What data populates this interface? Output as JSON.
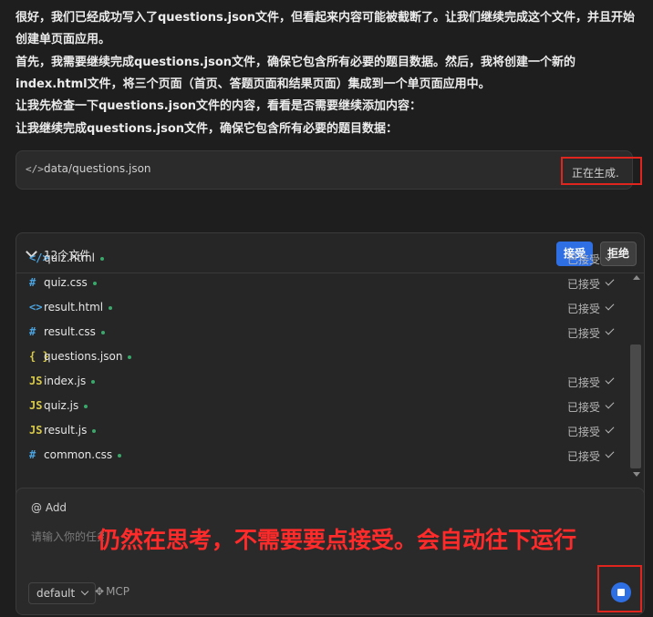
{
  "chat": {
    "para1": "很好，我们已经成功写入了questions.json文件，但看起来内容可能被截断了。让我们继续完成这个文件，并且开始创建单页面应用。",
    "para2": "首先，我需要继续完成questions.json文件，确保它包含所有必要的题目数据。然后，我将创建一个新的index.html文件，将三个页面（首页、答题页面和结果页面）集成到一个单页面应用中。",
    "para3": "让我先检查一下questions.json文件的内容，看看是否需要继续添加内容：",
    "para4": "让我继续完成questions.json文件，确保它包含所有必要的题目数据："
  },
  "file_pill": {
    "icon": "</>",
    "path": "data/questions.json",
    "status": "正在生成."
  },
  "files_panel": {
    "count_label": "12个文件",
    "accept_label": "接受",
    "reject_label": "拒绝",
    "files": [
      {
        "icon": "</>",
        "icon_color": "#4aa3df",
        "name": "quiz.html",
        "status": "已接受"
      },
      {
        "icon": "#",
        "icon_color": "#4aa3df",
        "name": "quiz.css",
        "status": "已接受"
      },
      {
        "icon": "<>",
        "icon_color": "#4aa3df",
        "name": "result.html",
        "status": "已接受"
      },
      {
        "icon": "#",
        "icon_color": "#4aa3df",
        "name": "result.css",
        "status": "已接受"
      },
      {
        "icon": "{ }",
        "icon_color": "#d7c84a",
        "name": "questions.json",
        "status": ""
      },
      {
        "icon": "JS",
        "icon_color": "#d7c84a",
        "name": "index.js",
        "status": "已接受"
      },
      {
        "icon": "JS",
        "icon_color": "#d7c84a",
        "name": "quiz.js",
        "status": "已接受"
      },
      {
        "icon": "JS",
        "icon_color": "#d7c84a",
        "name": "result.js",
        "status": "已接受"
      },
      {
        "icon": "#",
        "icon_color": "#4aa3df",
        "name": "common.css",
        "status": "已接受"
      }
    ]
  },
  "composer": {
    "add_label": "@ Add",
    "placeholder": "请输入你的任务",
    "model": "default",
    "mcp_label": "MCP"
  },
  "annotation": "仍然在思考，不需要要点接受。会自动往下运行"
}
